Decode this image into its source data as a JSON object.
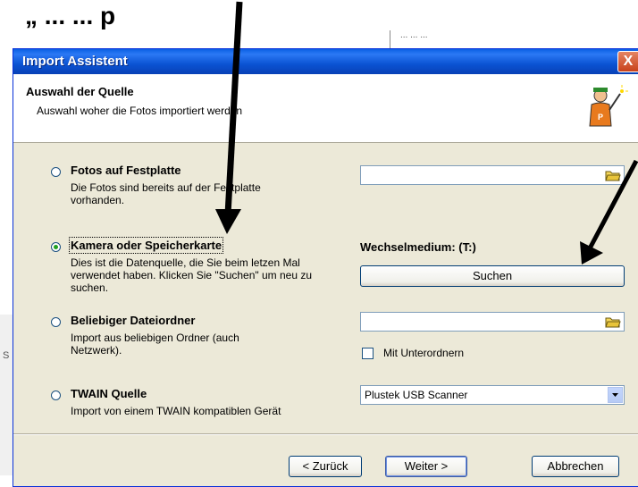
{
  "top_fragment": "„ ... ... p",
  "background_window_text": "... ... ...",
  "left_edge_mark": "S",
  "dialog": {
    "title": "Import Assistent",
    "close_label": "X",
    "header": {
      "title": "Auswahl der Quelle",
      "subtitle": "Auswahl woher die Fotos importiert werden",
      "icon": "wizard-mascot-icon"
    },
    "options": [
      {
        "title": "Fotos auf Festplatte",
        "description": "Die Fotos sind bereits auf der Festplatte vorhanden.",
        "selected": false
      },
      {
        "title": "Kamera oder Speicherkarte",
        "description": "Dies ist die Datenquelle, die Sie beim letzen Mal verwendet haben. Klicken Sie \"Suchen\" um neu zu suchen.",
        "selected": true
      },
      {
        "title": "Beliebiger Dateiordner",
        "description": "Import aus beliebigen Ordner (auch Netzwerk).",
        "selected": false
      },
      {
        "title": "TWAIN Quelle",
        "description": "Import von einem TWAIN kompatiblen Gerät",
        "selected": false
      }
    ],
    "path_field_1": {
      "value": ""
    },
    "wechsel_label": "Wechselmedium:  (T:)",
    "search_button": "Suchen",
    "path_field_2": {
      "value": ""
    },
    "subfolders_checkbox": {
      "label": "Mit Unterordnern",
      "checked": false
    },
    "scanner_select": {
      "value": "Plustek USB Scanner"
    },
    "footer": {
      "back": "< Zurück",
      "next": "Weiter >",
      "cancel": "Abbrechen"
    }
  },
  "colors": {
    "titlebar": "#0b53d3",
    "dialog_bg": "#ece9d8",
    "radio_dot": "#21a121",
    "arrow": "#000000"
  }
}
